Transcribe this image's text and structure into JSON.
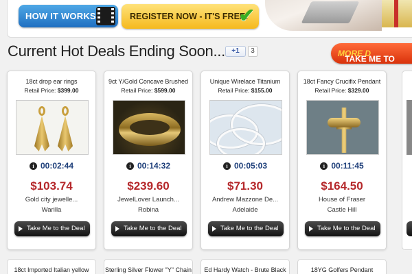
{
  "banner": {
    "how_it_works": "HOW IT WORKS",
    "register": "REGISTER NOW - IT'S FREE!"
  },
  "heading": "Current Hot Deals Ending Soon...",
  "social": {
    "plus_one": "+1",
    "count": "3"
  },
  "take_more": {
    "prefix": "TAKE ME TO ",
    "emph": "MORE D"
  },
  "deals": [
    {
      "title": "18ct drop ear rings",
      "retail_label": "Retail Price:",
      "retail": "$399.00",
      "timer": "00:02:44",
      "price": "$103.74",
      "seller": "Gold city jewelle...",
      "location": "Warilla",
      "button": "Take Me to the Deal"
    },
    {
      "title": "9ct Y/Gold Concave Brushed",
      "retail_label": "Retail Price:",
      "retail": "$599.00",
      "timer": "00:14:32",
      "price": "$239.60",
      "seller": "JewelLover Launch...",
      "location": "Robina",
      "button": "Take Me to the Deal"
    },
    {
      "title": "Unique Wirelace Titanium",
      "retail_label": "Retail Price:",
      "retail": "$155.00",
      "timer": "00:05:03",
      "price": "$71.30",
      "seller": "Andrew Mazzone De...",
      "location": "Adelaide",
      "button": "Take Me to the Deal"
    },
    {
      "title": "18ct Fancy Crucifix Pendant",
      "retail_label": "Retail Price:",
      "retail": "$329.00",
      "timer": "00:11:45",
      "price": "$164.50",
      "seller": "House of Fraser",
      "location": "Castle Hill",
      "button": "Take Me to the Deal"
    }
  ],
  "next_row": [
    "18ct Imported Italian yellow",
    "Sterling Silver Flower \"Y\" Chain",
    "Ed Hardy Watch - Brute Black",
    "18YG Golfers Pendant"
  ]
}
